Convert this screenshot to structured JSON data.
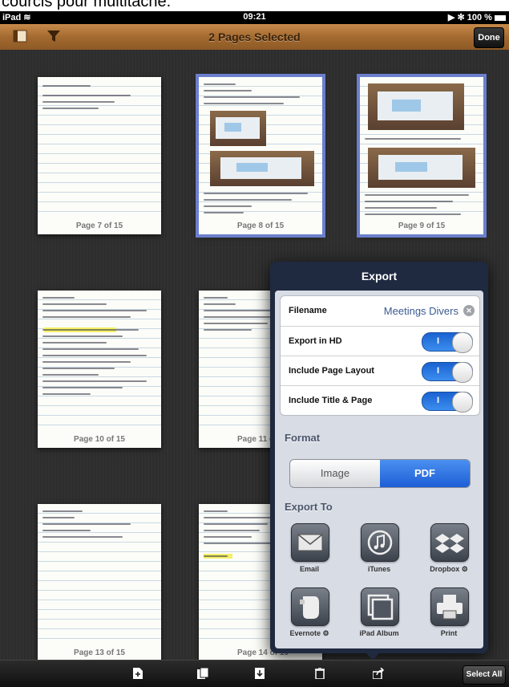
{
  "caption": {
    "text": "courcis pour multitâche."
  },
  "status_bar": {
    "device": "iPad",
    "time": "09:21",
    "battery": "100 %"
  },
  "toolbar": {
    "title": "2 Pages Selected",
    "done_label": "Done"
  },
  "pages": [
    {
      "label": "Page 7 of 15",
      "selected": false
    },
    {
      "label": "Page 8 of 15",
      "selected": true
    },
    {
      "label": "Page 9 of 15",
      "selected": true
    },
    {
      "label": "Page 10 of 15",
      "selected": false
    },
    {
      "label": "Page 11 of 15",
      "selected": false
    },
    {
      "label": "Page 13 of 15",
      "selected": false
    },
    {
      "label": "Page 14 of 15",
      "selected": false
    }
  ],
  "export": {
    "title": "Export",
    "filename_label": "Filename",
    "filename_value": "Meetings Divers",
    "export_hd_label": "Export in HD",
    "include_layout_label": "Include Page Layout",
    "include_title_label": "Include Title & Page",
    "toggle_on": "I",
    "format_header": "Format",
    "format_options": [
      "Image",
      "PDF"
    ],
    "format_selected": "PDF",
    "export_to_header": "Export To",
    "destinations": [
      "Email",
      "iTunes",
      "Dropbox",
      "Evernote",
      "iPad Album",
      "Print"
    ]
  },
  "bottom_bar": {
    "select_all_label": "Select All"
  },
  "icons": [
    "sidebar-icon",
    "filter-icon",
    "add-page-icon",
    "duplicate-icon",
    "move-icon",
    "trash-icon",
    "share-icon",
    "wifi-icon",
    "battery-icon",
    "play-icon",
    "bluetooth-icon"
  ]
}
